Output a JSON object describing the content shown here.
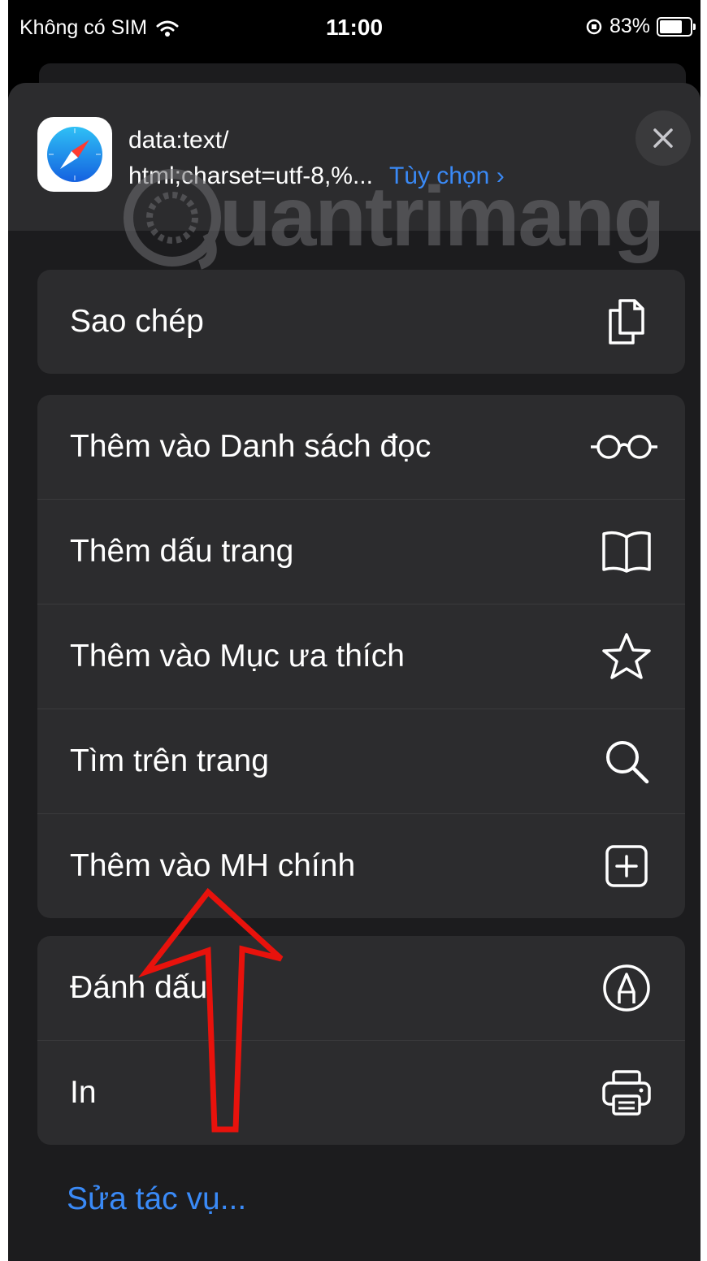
{
  "status_bar": {
    "carrier": "Không có SIM",
    "time": "11:00",
    "battery": "83%",
    "battery_level": 0.83
  },
  "share_sheet": {
    "url_line1": "data:text/",
    "url_line2": "html;charset=utf-8,%...",
    "options_label": "Tùy chọn",
    "options_chevron": "›",
    "app_icon": "safari-icon",
    "close_icon": "close-icon"
  },
  "groups": [
    {
      "items": [
        {
          "label": "Sao chép",
          "icon": "copy-icon"
        }
      ]
    },
    {
      "items": [
        {
          "label": "Thêm vào Danh sách đọc",
          "icon": "glasses-icon"
        },
        {
          "label": "Thêm dấu trang",
          "icon": "book-icon"
        },
        {
          "label": "Thêm vào Mục ưa thích",
          "icon": "star-icon"
        },
        {
          "label": "Tìm trên trang",
          "icon": "search-icon"
        },
        {
          "label": "Thêm vào MH chính",
          "icon": "add-square-icon"
        }
      ]
    },
    {
      "items": [
        {
          "label": "Đánh dấu",
          "icon": "markup-icon"
        },
        {
          "label": "In",
          "icon": "printer-icon"
        }
      ]
    }
  ],
  "edit_actions_label": "Sửa tác vụ...",
  "watermark": {
    "text": "uantrimang",
    "icon": "quantrimang-logo"
  },
  "annotation": {
    "icon": "red-arrow-icon",
    "color": "#e8120c"
  },
  "colors": {
    "accent": "#3a8af7",
    "sheet": "#1c1c1e",
    "group": "#2c2c2e"
  }
}
